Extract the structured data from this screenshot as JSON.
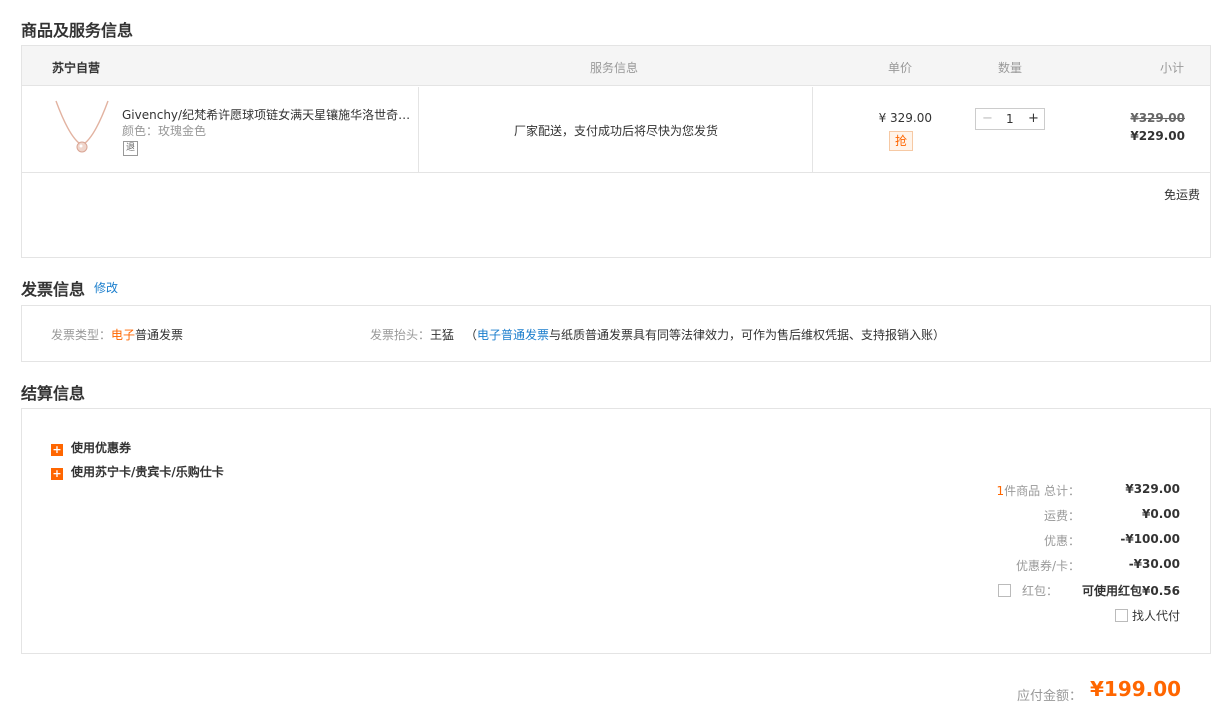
{
  "sections": {
    "goods_title": "商品及服务信息",
    "invoice_title": "发票信息",
    "invoice_edit": "修改",
    "settle_title": "结算信息"
  },
  "goods_header": {
    "store": "苏宁自营",
    "service": "服务信息",
    "unit_price": "单价",
    "quantity": "数量",
    "subtotal": "小计"
  },
  "item": {
    "name": "Givenchy/纪梵希许愿球项链女满天星镶施华洛世奇元素水晶吊坠",
    "color_label": "颜色：",
    "color_value": "玫瑰金色",
    "return_badge": "退",
    "service": "厂家配送，支付成功后将尽快为您发货",
    "price": "¥ 329.00",
    "badge": "抢",
    "qty": "1",
    "qty_minus": "−",
    "qty_plus": "+",
    "old_total": "¥329.00",
    "new_total": "¥229.00",
    "shipping": "免运费"
  },
  "invoice": {
    "type_label": "发票类型：",
    "type_highlight": "电子",
    "type_rest": "普通发票",
    "title_label": "发票抬头：",
    "title_value": "王猛",
    "note_open": "（",
    "note_link": "电子普通发票",
    "note_rest": "与纸质普通发票具有同等法律效力，可作为售后维权凭据、支持报销入账）"
  },
  "settle": {
    "opt_coupon": "使用优惠券",
    "opt_card": "使用苏宁卡/贵宾卡/乐购仕卡",
    "count_num": "1",
    "count_label": "件商品 总计：",
    "total": "¥329.00",
    "freight_label": "运费：",
    "freight": "¥0.00",
    "discount_label": "优惠：",
    "discount": "-¥100.00",
    "coupon_label": "优惠券/卡：",
    "coupon": "-¥30.00",
    "redpack_label": "红包：",
    "redpack": "可使用红包¥0.56",
    "proxy_pay": "找人代付",
    "payable_label": "应付金额：",
    "payable": "¥199.00"
  },
  "colors": {
    "accent": "#ff6600",
    "link": "#1b7ecd"
  }
}
